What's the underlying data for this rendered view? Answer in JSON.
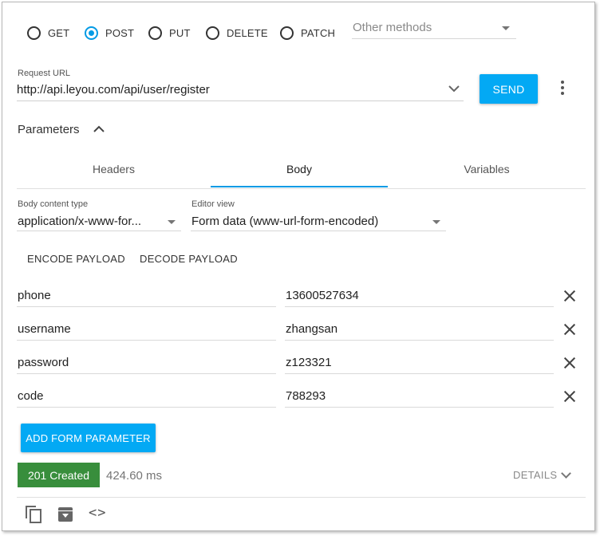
{
  "methods": [
    {
      "label": "GET",
      "checked": false
    },
    {
      "label": "POST",
      "checked": true
    },
    {
      "label": "PUT",
      "checked": false
    },
    {
      "label": "DELETE",
      "checked": false
    },
    {
      "label": "PATCH",
      "checked": false
    }
  ],
  "other_methods": {
    "placeholder": "Other methods"
  },
  "request": {
    "url_label": "Request URL",
    "url": "http://api.leyou.com/api/user/register",
    "send_label": "SEND"
  },
  "parameters": {
    "title": "Parameters",
    "tabs": [
      {
        "label": "Headers",
        "active": false
      },
      {
        "label": "Body",
        "active": true
      },
      {
        "label": "Variables",
        "active": false
      }
    ]
  },
  "body": {
    "content_type_label": "Body content type",
    "content_type_value": "application/x-www-for...",
    "editor_view_label": "Editor view",
    "editor_view_value": "Form data (www-url-form-encoded)",
    "encode_label": "ENCODE PAYLOAD",
    "decode_label": "DECODE PAYLOAD",
    "form_params": [
      {
        "name": "phone",
        "value": "13600527634"
      },
      {
        "name": "username",
        "value": "zhangsan"
      },
      {
        "name": "password",
        "value": "z123321"
      },
      {
        "name": "code",
        "value": "788293"
      }
    ],
    "add_label": "ADD FORM PARAMETER"
  },
  "response": {
    "status": "201 Created",
    "status_color": "#388e3c",
    "timing": "424.60 ms",
    "details_label": "DETAILS"
  },
  "colors": {
    "accent": "#03a9f4"
  },
  "icons": [
    "copy-icon",
    "archive-icon",
    "code-icon",
    "close-icon",
    "chevron-down-icon",
    "more-vert-icon",
    "chevron-up-icon"
  ]
}
